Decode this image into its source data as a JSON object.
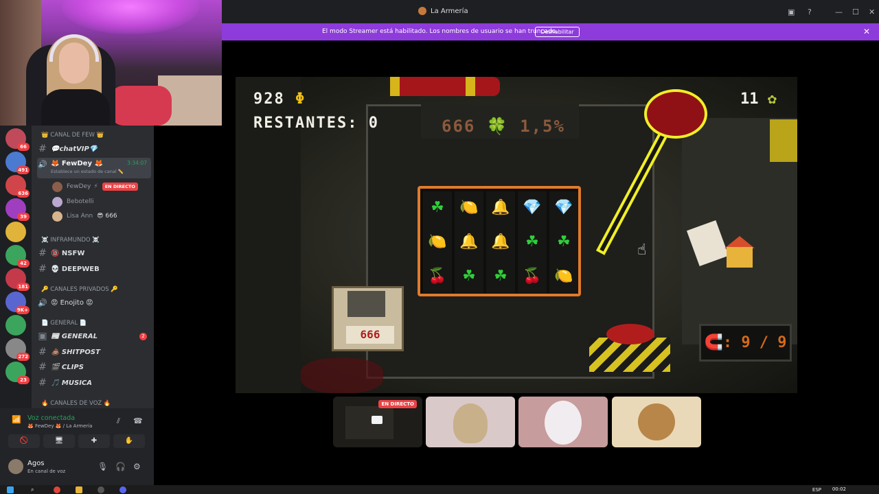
{
  "window": {
    "title": "La Armería",
    "controls": [
      "minimize",
      "maximize",
      "close"
    ]
  },
  "banner": {
    "message": "El modo Streamer está habilitado. Los nombres de usuario se han truncado.",
    "button": "Deshabilitar"
  },
  "servers": [
    {
      "badge": "66",
      "color": "#c04a5a"
    },
    {
      "badge": "491",
      "color": "#4a7bd0"
    },
    {
      "badge": "636",
      "color": "#d0454a"
    },
    {
      "badge": "39",
      "color": "#a03ec0"
    },
    {
      "badge": "",
      "color": "#e0b33a"
    },
    {
      "badge": "42",
      "color": "#3ba55d"
    },
    {
      "badge": "181",
      "color": "#c43a4a"
    },
    {
      "badge": "9K+",
      "color": "#5a66d0"
    },
    {
      "badge": "",
      "color": "#3ba55d"
    },
    {
      "badge": "272",
      "color": "#888"
    },
    {
      "badge": "23",
      "color": "#3ba55d"
    }
  ],
  "sidebar": {
    "categories": [
      "👑 CANAL DE FEW 👑",
      "☠️ INFRAMUNDO ☠️",
      "🔑 CANALES PRIVADOS 🔑",
      "📄 GENERAL 📄",
      "🔥 CANALES DE VOZ 🔥"
    ],
    "channels": {
      "chatvip": "💬chatVIP💎",
      "fewdey": "🦊 FewDey 🦊",
      "fewdey_time": "3:34:07",
      "fewdey_sub": "Establece un estado de canal ✏️",
      "nsfw": "🔞 NSFW",
      "deepweb": "💀 DEEPWEB",
      "enojito": "😡 Enojito 😡",
      "general": "📰 GENERAL",
      "general_count": "2",
      "shitpost": "💩 SHITPOST",
      "clips": "🎬 CLIPS",
      "musica": "🎵 MUSICA"
    },
    "voice_users": [
      {
        "name": "FewDey",
        "live": "EN DIRECTO"
      },
      {
        "name": "Bebotelli",
        "live": ""
      },
      {
        "name": "Lisa Ann",
        "extra": "😎 666"
      }
    ]
  },
  "voice": {
    "status": "Voz conectada",
    "location": "🦊 FewDey 🦊 / La Armería"
  },
  "user": {
    "name": "Agos",
    "status": "En canal de voz"
  },
  "game": {
    "money": "928",
    "money_symbol": "Φ",
    "remaining": "RESTANTES: 0",
    "tickets": "11",
    "odds": "666 🍀 1,5%",
    "floppy_label": "666",
    "counter": "🧲: 9 / 9",
    "reels": [
      [
        "☘",
        "🍋",
        "🔔",
        "💎",
        "💎"
      ],
      [
        "🍋",
        "🔔",
        "🔔",
        "☘",
        "☘"
      ],
      [
        "🍒",
        "☘",
        "☘",
        "🍒",
        "🍋"
      ]
    ]
  },
  "tiles": {
    "live_badge": "EN DIRECTO"
  },
  "taskbar": {
    "lang": "ESP",
    "time": "00:02"
  },
  "colors": {
    "banner": "#8e3bdb",
    "live": "#ed4245",
    "reel_border": "#e07b2a",
    "lever_outline": "#f1ef26"
  }
}
